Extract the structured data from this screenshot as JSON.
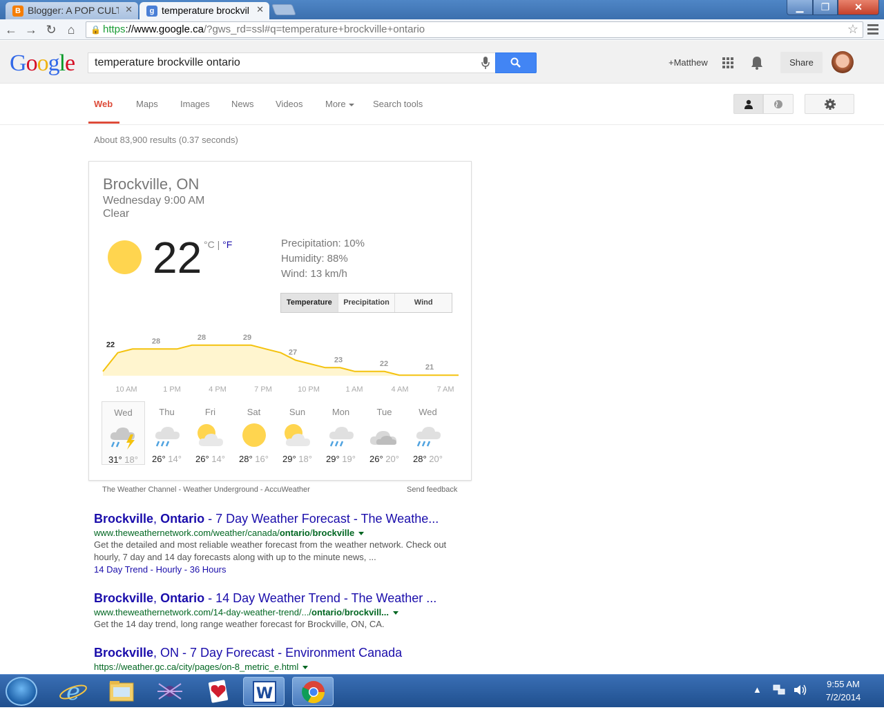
{
  "browser": {
    "tabs": [
      {
        "title": "Blogger: A POP CULT",
        "favicon": "blogger-icon"
      },
      {
        "title": "temperature brockvil",
        "favicon": "google-icon"
      }
    ],
    "url_scheme": "https",
    "url_host": "://www.google.ca",
    "url_path": "/?gws_rd=ssl#q=temperature+brockville+ontario"
  },
  "header": {
    "logo_letters": [
      "G",
      "o",
      "o",
      "g",
      "l",
      "e"
    ],
    "query": "temperature brockville ontario",
    "user": "+Matthew",
    "share": "Share"
  },
  "nav": {
    "tabs": [
      "Web",
      "Maps",
      "Images",
      "News",
      "Videos",
      "More",
      "Search tools"
    ]
  },
  "stats": "About 83,900 results (0.37 seconds)",
  "weather": {
    "location": "Brockville, ON",
    "time": "Wednesday 9:00 AM",
    "condition": "Clear",
    "temperature": "22",
    "unit_c": "°C",
    "unit_sep": " | ",
    "unit_f": "°F",
    "precipitation": "Precipitation: 10%",
    "humidity": "Humidity: 88%",
    "wind": "Wind: 13 km/h",
    "buttons": [
      "Temperature",
      "Precipitation",
      "Wind"
    ],
    "colors": {
      "sun": "#ffd54f",
      "line": "#f4c20d",
      "area": "#fff5cf"
    },
    "forecast": [
      {
        "day": "Wed",
        "hi": "31°",
        "lo": "18°",
        "icon": "thunderstorm-icon"
      },
      {
        "day": "Thu",
        "hi": "26°",
        "lo": "14°",
        "icon": "rain-icon"
      },
      {
        "day": "Fri",
        "hi": "26°",
        "lo": "14°",
        "icon": "partly-cloudy-icon"
      },
      {
        "day": "Sat",
        "hi": "28°",
        "lo": "16°",
        "icon": "sunny-icon"
      },
      {
        "day": "Sun",
        "hi": "29°",
        "lo": "18°",
        "icon": "partly-cloudy-icon"
      },
      {
        "day": "Mon",
        "hi": "29°",
        "lo": "19°",
        "icon": "rain-icon"
      },
      {
        "day": "Tue",
        "hi": "26°",
        "lo": "20°",
        "icon": "cloudy-icon"
      },
      {
        "day": "Wed",
        "hi": "28°",
        "lo": "20°",
        "icon": "rain-icon"
      }
    ],
    "sources": "The Weather Channel - Weather Underground - AccuWeather",
    "feedback": "Send feedback"
  },
  "chart_data": {
    "type": "area",
    "x": [
      "9 AM",
      "10 AM",
      "11 AM",
      "12 PM",
      "1 PM",
      "2 PM",
      "3 PM",
      "4 PM",
      "5 PM",
      "6 PM",
      "7 PM",
      "8 PM",
      "9 PM",
      "10 PM",
      "11 PM",
      "12 AM",
      "1 AM",
      "2 AM",
      "3 AM",
      "4 AM",
      "5 AM",
      "6 AM",
      "7 AM",
      "8 AM",
      "9 AM"
    ],
    "values": [
      22,
      27,
      28,
      28,
      28,
      28,
      29,
      29,
      29,
      29,
      29,
      28,
      27,
      25,
      24,
      23,
      23,
      22,
      22,
      22,
      21,
      21,
      21,
      21,
      21
    ],
    "point_labels": [
      {
        "index": 0,
        "text": "22"
      },
      {
        "index": 2,
        "text": "28"
      },
      {
        "index": 4,
        "text": "28"
      },
      {
        "index": 6,
        "text": "29"
      },
      {
        "index": 8,
        "text": "27"
      },
      {
        "index": 10,
        "text": "23"
      },
      {
        "index": 12,
        "text": "22"
      },
      {
        "index": 14,
        "text": "21"
      }
    ],
    "tick_labels": [
      "10 AM",
      "1 PM",
      "4 PM",
      "7 PM",
      "10 PM",
      "1 AM",
      "4 AM",
      "7 AM"
    ]
  },
  "results": [
    {
      "title_parts": [
        "Brockville",
        ", ",
        "Ontario",
        " - 7 Day Weather Forecast - The Weathe..."
      ],
      "url_parts": [
        "www.theweathernetwork.com/weather/canada/",
        "ontario",
        "/",
        "brockville"
      ],
      "snippet": "Get the detailed and most reliable weather forecast from the weather network. Check out hourly, 7 day and 14 day forecasts along with up to the minute news, ...",
      "sitelinks": "14 Day Trend - Hourly - 36 Hours"
    },
    {
      "title_parts": [
        "Brockville",
        ", ",
        "Ontario",
        " - 14 Day Weather Trend - The Weather ..."
      ],
      "url_parts": [
        "www.theweathernetwork.com/14-day-weather-trend/.../",
        "ontario",
        "/",
        "brockvill..."
      ],
      "snippet": "Get the 14 day trend, long range weather forecast for Brockville, ON, CA."
    },
    {
      "title_parts": [
        "Brockville",
        ", ON - 7 Day Forecast - Environment Canada"
      ],
      "url": "https://weather.gc.ca/city/pages/on-8_metric_e.html"
    }
  ],
  "taskbar": {
    "time": "9:55 AM",
    "date": "7/2/2014",
    "apps": [
      "internet-explorer-icon",
      "file-explorer-icon",
      "spider-solitaire-icon",
      "hearts-icon",
      "word-icon",
      "chrome-icon"
    ]
  }
}
